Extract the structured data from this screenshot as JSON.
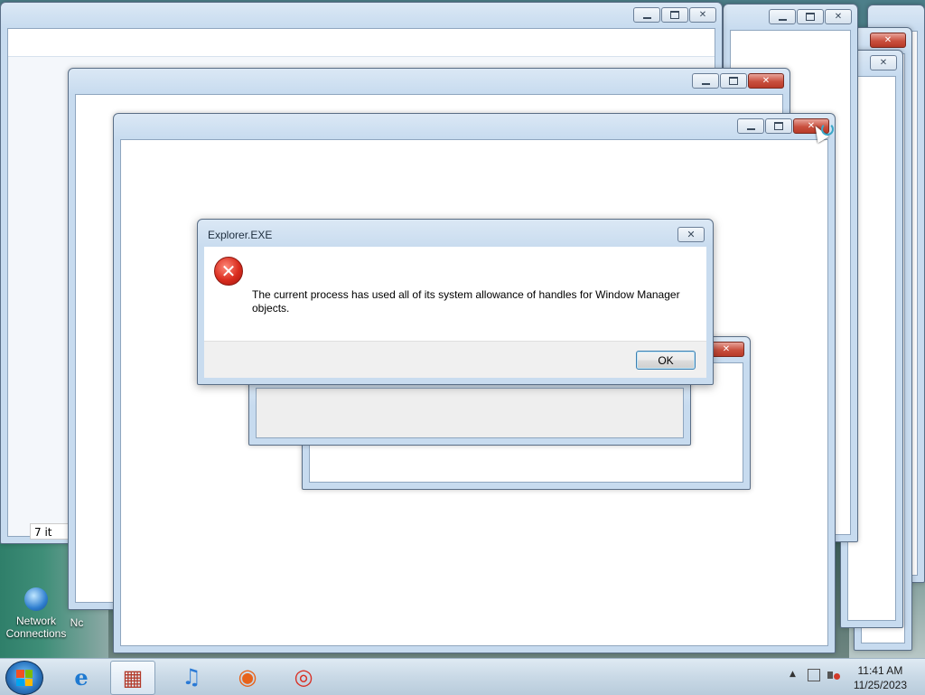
{
  "dialog": {
    "title": "Explorer.EXE",
    "message": "The current process has used all of its system allowance of handles for Window Manager objects.",
    "ok_label": "OK",
    "close_glyph": "✕"
  },
  "background_windows": {
    "count": 9,
    "status_fragment": "7 it"
  },
  "desktop": {
    "icons": [
      {
        "label": "Network Connections",
        "icon": "network-globe-icon"
      },
      {
        "label": "Nc",
        "icon": "unknown-icon"
      }
    ]
  },
  "taskbar": {
    "items": [
      {
        "name": "internet-explorer",
        "icon": "ie-icon",
        "glyph": "e"
      },
      {
        "name": "file-explorer",
        "icon": "explorer-icon",
        "glyph": "▦",
        "active": true
      },
      {
        "name": "itunes",
        "icon": "music-icon",
        "glyph": "♫"
      },
      {
        "name": "firefox",
        "icon": "firefox-icon",
        "glyph": "◉"
      },
      {
        "name": "chrome",
        "icon": "chrome-icon",
        "glyph": "◎"
      }
    ],
    "clock": {
      "time": "11:41 AM",
      "date": "11/25/2023"
    },
    "tray": {
      "chevron": "▲",
      "network": "network-icon",
      "volume": "mute-volume-icon"
    }
  },
  "colors": {
    "close_red": "#c9503e",
    "chrome_blue": "#c7dbef",
    "ok_border": "#3c7fb1"
  }
}
